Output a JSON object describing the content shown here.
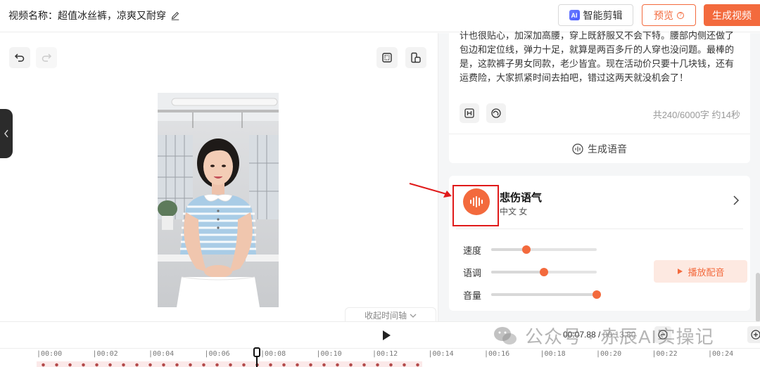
{
  "header": {
    "video_title_label": "视频名称：",
    "video_title": "超值冰丝裤，凉爽又耐穿",
    "ai_edit_label": "智能剪辑",
    "ai_badge": "AI",
    "preview_label": "预览",
    "generate_label": "生成视频"
  },
  "canvas": {
    "collapse_timeline_label": "收起时间轴"
  },
  "script": {
    "text": "计也很贴心，加深加高腰，穿上既舒服又不会下特。腰部内侧还做了包边和定位线，弹力十足，就算是两百多斤的人穿也没问题。最棒的是，这款裤子男女同款，老少皆宜。现在活动价只要十几块钱，还有运费险，大家抓紧时间去拍吧，错过这两天就没机会了！",
    "count": "共240/6000字 约14秒",
    "generate_voice_label": "生成语音"
  },
  "voice": {
    "name": "悲伤语气",
    "meta": "中文  女",
    "sliders": [
      {
        "label": "速度",
        "value": 0.33
      },
      {
        "label": "语调",
        "value": 0.5
      },
      {
        "label": "音量",
        "value": 1.0
      }
    ],
    "play_label": "播放配音"
  },
  "timeline": {
    "current_time": "00:07.88",
    "separator": " / ",
    "total_time": "00:13.80",
    "ticks": [
      "00:00",
      "00:02",
      "00:04",
      "00:06",
      "00:08",
      "00:10",
      "00:12",
      "00:14",
      "00:16",
      "00:18",
      "00:20",
      "00:22",
      "00:24"
    ]
  },
  "watermark": {
    "text": "公众号 · 赤辰AI实操记"
  },
  "colors": {
    "accent": "#f36a3d",
    "highlight_red": "#e01a1a",
    "ai_blue": "#4a5cff"
  }
}
